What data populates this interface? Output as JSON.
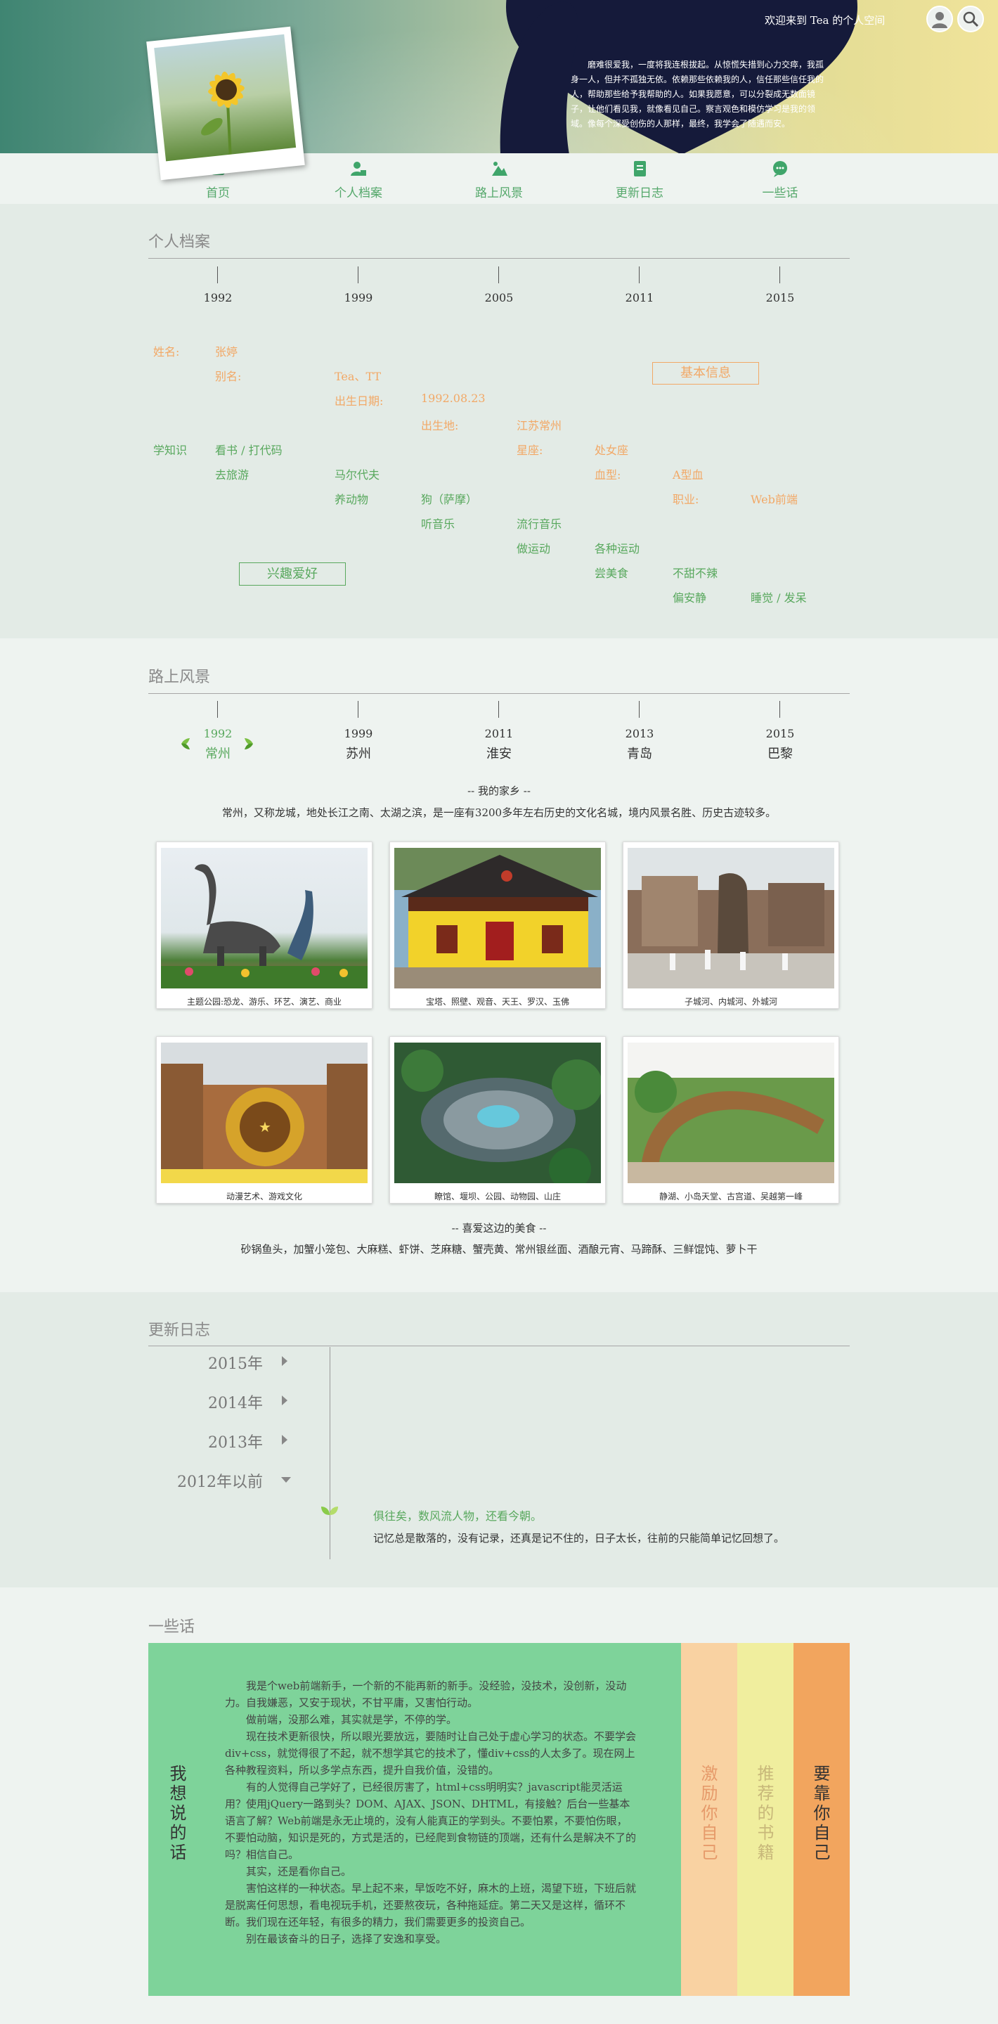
{
  "header": {
    "welcome": "欢迎来到 Tea 的个人空间",
    "intro": "磨难很爱我，一度将我连根拔起。从惊慌失措到心力交瘁，我孤身一人，但并不孤独无依。依赖那些依赖我的人，信任那些信任我的人，帮助那些给予我帮助的人。如果我愿意，可以分裂成无数面镜子，让他们看见我，就像看见自己。察言观色和模仿学习是我的领域。像每个深受创伤的人那样，最终，我学会了随遇而安。",
    "icons": [
      "user-icon",
      "search-icon"
    ]
  },
  "nav": [
    {
      "label": "首页",
      "icon": "home-icon"
    },
    {
      "label": "个人档案",
      "icon": "profile-icon"
    },
    {
      "label": "路上风景",
      "icon": "scenery-icon"
    },
    {
      "label": "更新日志",
      "icon": "log-icon"
    },
    {
      "label": "一些话",
      "icon": "chat-icon"
    }
  ],
  "profile": {
    "title": "个人档案",
    "years": [
      "1992",
      "1999",
      "2005",
      "2011",
      "2015"
    ],
    "rows": {
      "name_label": "姓名:",
      "name": "张婷",
      "alias_label": "别名:",
      "alias": "Tea、TT",
      "birth_label": "出生日期:",
      "birth": "1992.08.23",
      "place_label": "出生地:",
      "place": "江苏常州",
      "star_label": "星座:",
      "star": "处女座",
      "blood_label": "血型:",
      "blood": "A型血",
      "job_label": "职业:",
      "job": "Web前端",
      "basic_box": "基本信息",
      "learn": "学知识",
      "read": "看书 / 打代码",
      "travel": "去旅游",
      "maldives": "马尔代夫",
      "pet": "养动物",
      "dog": "狗（萨摩）",
      "music": "听音乐",
      "pop": "流行音乐",
      "sport": "做运动",
      "sports": "各种运动",
      "food": "尝美食",
      "spicy": "不甜不辣",
      "quiet": "偏安静",
      "sleep": "睡觉 / 发呆",
      "hobby_box": "兴趣爱好"
    }
  },
  "scenery": {
    "title": "路上风景",
    "stops": [
      {
        "year": "1992",
        "city": "常州"
      },
      {
        "year": "1999",
        "city": "苏州"
      },
      {
        "year": "2011",
        "city": "淮安"
      },
      {
        "year": "2013",
        "city": "青岛"
      },
      {
        "year": "2015",
        "city": "巴黎"
      }
    ],
    "home_title": "-- 我的家乡 --",
    "home_desc": "常州，又称龙城，地处长江之南、太湖之滨，是一座有3200多年左右历史的文化名城，境内风景名胜、历史古迹较多。",
    "photos": [
      "主题公园:恐龙、游乐、环艺、演艺、商业",
      "宝塔、照壁、观音、天王、罗汉、玉佛",
      "子城河、内城河、外城河",
      "动漫艺术、游戏文化",
      "瞭馆、堰坝、公园、动物园、山庄",
      "静湖、小岛天堂、古宫道、吴越第一峰"
    ],
    "food_title": "-- 喜爱这边的美食 --",
    "food_desc": "砂锅鱼头，加蟹小笼包、大麻糕、虾饼、芝麻糖、蟹壳黄、常州银丝面、酒酿元宵、马蹄酥、三鲜馄饨、萝卜干"
  },
  "log": {
    "title": "更新日志",
    "years": [
      "2015年",
      "2014年",
      "2013年",
      "2012年以前"
    ],
    "entry_title": "俱往矣，数风流人物，还看今朝。",
    "entry_text": "记忆总是散落的，没有记录，还真是记不住的，日子太长，往前的只能简单记忆回想了。"
  },
  "words": {
    "title": "一些话",
    "side": "我想说的话",
    "paragraphs": [
      "我是个web前端新手，一个新的不能再新的新手。没经验，没技术，没创新，没动力。自我嫌恶，又安于现状，不甘平庸，又害怕行动。",
      "做前端，没那么难，其实就是学，不停的学。",
      "现在技术更新很快，所以眼光要放远，要随时让自己处于虚心学习的状态。不要学会div+css，就觉得很了不起，就不想学其它的技术了，懂div+css的人太多了。现在网上各种教程资料，所以多学点东西，提升自我价值，没错的。",
      "有的人觉得自己学好了，已经很厉害了，html+css明明实？javascript能灵活运用？使用jQuery一路到头？DOM、AJAX、JSON、DHTML，有接触？后台一些基本语言了解？Web前端是永无止境的，没有人能真正的学到头。不要怕累，不要怕伤眼，不要怕动脑，知识是死的，方式是活的，已经爬到食物链的顶端，还有什么是解决不了的吗？相信自己。",
      "其实，还是看你自己。",
      "害怕这样的一种状态。早上起不来，早饭吃不好，麻木的上班，渴望下班，下班后就是脱离任何思想，看电视玩手机，还要熬夜玩，各种拖延症。第二天又是这样，循环不断。我们现在还年轻，有很多的精力，我们需要更多的投资自己。",
      "别在最该奋斗的日子，选择了安逸和享受。"
    ],
    "col1": "激励你自己",
    "col2": "推荐的书籍",
    "col3": "要靠你自己"
  }
}
